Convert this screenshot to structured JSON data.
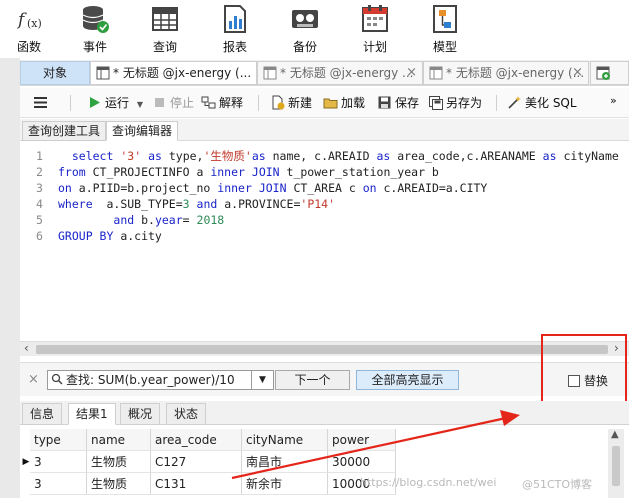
{
  "toolbar": {
    "items": [
      {
        "label": "函数",
        "icon": "function-icon"
      },
      {
        "label": "事件",
        "icon": "database-event-icon"
      },
      {
        "label": "查询",
        "icon": "query-grid-icon"
      },
      {
        "label": "报表",
        "icon": "report-chart-icon"
      },
      {
        "label": "备份",
        "icon": "backup-tape-icon"
      },
      {
        "label": "计划",
        "icon": "calendar-icon"
      },
      {
        "label": "模型",
        "icon": "model-diagram-icon"
      }
    ]
  },
  "tabs": {
    "object_label": "对象",
    "items": [
      {
        "label": "* 无标题 @jx-energy (..."
      },
      {
        "label": "* 无标题 @jx-energy ..."
      },
      {
        "label": "* 无标题 @jx-energy (..."
      }
    ]
  },
  "editor_toolbar": {
    "run": "运行",
    "stop": "停止",
    "explain": "解释",
    "new": "新建",
    "load": "加载",
    "save": "保存",
    "save_as": "另存为",
    "beautify": "美化 SQL"
  },
  "sub_tabs": {
    "builder": "查询创建工具",
    "editor": "查询编辑器"
  },
  "code": {
    "line_numbers": [
      "1",
      "2",
      "3",
      "4",
      "5",
      "6"
    ]
  },
  "find": {
    "query": "查找: SUM(b.year_power)/10",
    "next": "下一个",
    "highlight_all": "全部高亮显示",
    "replace": "替换"
  },
  "result_tabs": {
    "info": "信息",
    "result1": "结果1",
    "overview": "概况",
    "status": "状态"
  },
  "grid": {
    "columns": [
      "type",
      "name",
      "area_code",
      "cityName",
      "power"
    ],
    "rows": [
      [
        "3",
        "生物质",
        "C127",
        "南昌市",
        "30000"
      ],
      [
        "3",
        "生物质",
        "C131",
        "新余市",
        "10000"
      ]
    ]
  },
  "watermark": {
    "left": "https://blog.csdn.net/wei",
    "right": "@51CTO博客"
  },
  "colors": {
    "annotation": "#e4261a",
    "keyword": "#1a24c9",
    "string": "#c0392b",
    "number": "#2e8b57"
  }
}
